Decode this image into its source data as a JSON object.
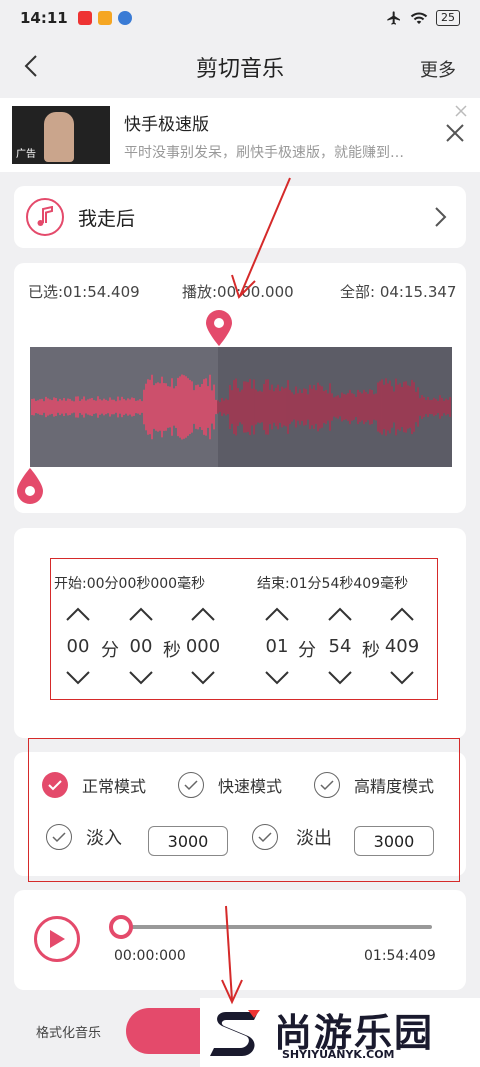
{
  "status": {
    "time": "14:11",
    "battery": "25"
  },
  "nav": {
    "title": "剪切音乐",
    "more": "更多"
  },
  "ad": {
    "title": "快手极速版",
    "desc": "平时没事别发呆，刷快手极速版，就能赚到…",
    "thumb_tag": "广告"
  },
  "song": {
    "name": "我走后"
  },
  "wave": {
    "selected": "已选:01:54.409",
    "play": "播放:00:00.000",
    "total": "全部: 04:15.347",
    "progress_fraction": 0.445
  },
  "trim": {
    "start_label": "开始:00分00秒000毫秒",
    "end_label": "结束:01分54秒409毫秒",
    "start": {
      "min": "00",
      "sec": "00",
      "ms": "000"
    },
    "end": {
      "min": "01",
      "sec": "54",
      "ms": "409"
    },
    "unit_min": "分",
    "unit_sec": "秒"
  },
  "modes": {
    "normal": "正常模式",
    "fast": "快速模式",
    "precise": "高精度模式",
    "fade_in": "淡入",
    "fade_in_value": "3000",
    "fade_out": "淡出",
    "fade_out_value": "3000"
  },
  "player": {
    "current": "00:00:000",
    "duration": "01:54:409",
    "progress_fraction": 0.0
  },
  "bottom": {
    "format_label": "格式化音乐"
  },
  "watermark": {
    "brand": "尚游乐园",
    "url": "SHYIYUANYK.COM"
  },
  "colors": {
    "accent": "#e44a6b",
    "annotation": "#d52a2a"
  }
}
